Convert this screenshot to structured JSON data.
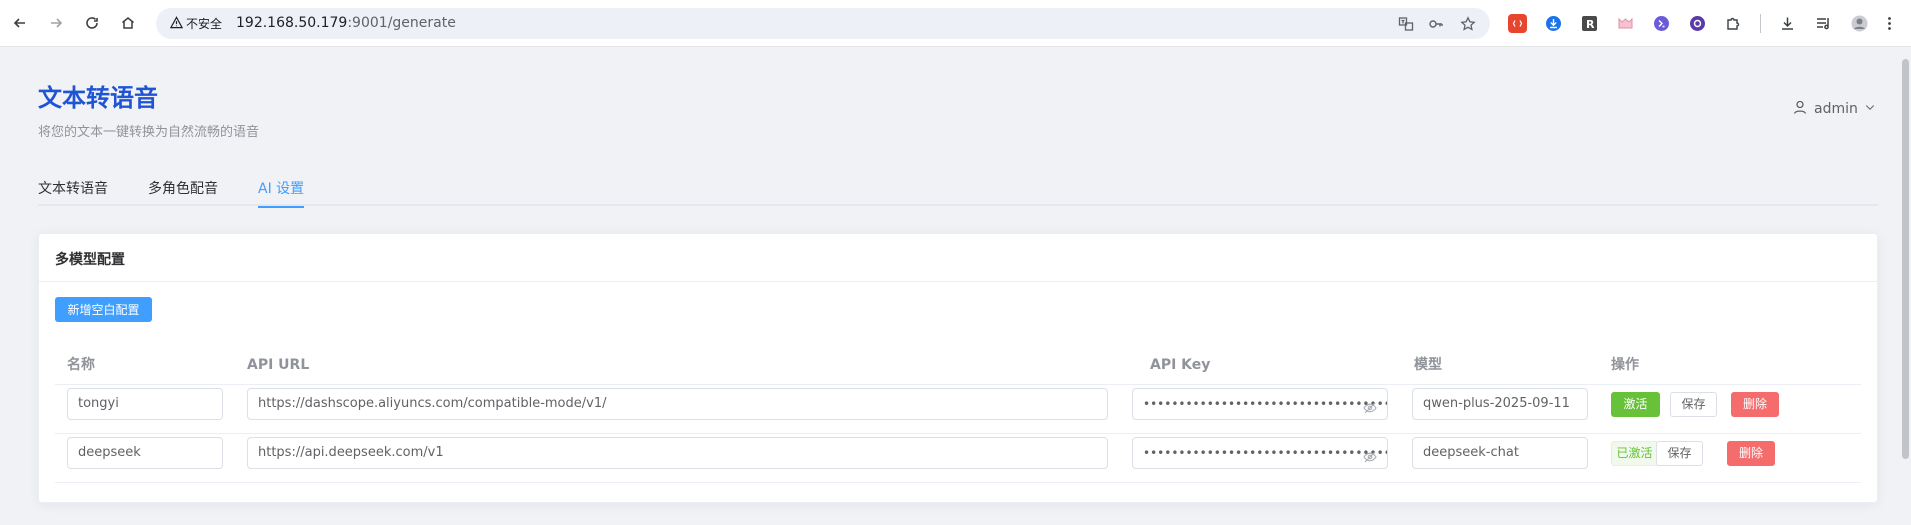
{
  "browser": {
    "security_label": "不安全",
    "url_host": "192.168.50.179",
    "url_path": ":9001/generate"
  },
  "page": {
    "title": "文本转语音",
    "subtitle": "将您的文本一键转换为自然流畅的语音",
    "user": "admin"
  },
  "tabs": [
    {
      "label": "文本转语音",
      "active": false
    },
    {
      "label": "多角色配音",
      "active": false
    },
    {
      "label": "AI 设置",
      "active": true
    }
  ],
  "card": {
    "title": "多模型配置",
    "add_button": "新增空白配置",
    "columns": [
      "名称",
      "API URL",
      "API Key",
      "模型",
      "操作"
    ],
    "rows": [
      {
        "name": "tongyi",
        "api_url": "https://dashscope.aliyuncs.com/compatible-mode/v1/",
        "api_key_masked": "••••••••••••••••••••••••••••••••••••",
        "model": "qwen-plus-2025-09-11",
        "activate_label": "激活",
        "save_label": "保存",
        "delete_label": "删除"
      },
      {
        "name": "deepseek",
        "api_url": "https://api.deepseek.com/v1",
        "api_key_masked": "••••••••••••••••••••••••••••••••••••",
        "model": "deepseek-chat",
        "activate_label": "已激活",
        "save_label": "保存",
        "delete_label": "删除"
      }
    ]
  },
  "colors": {
    "accent": "#409eff",
    "title": "#1f55d4",
    "success": "#67c23a",
    "danger": "#f56c6c"
  }
}
